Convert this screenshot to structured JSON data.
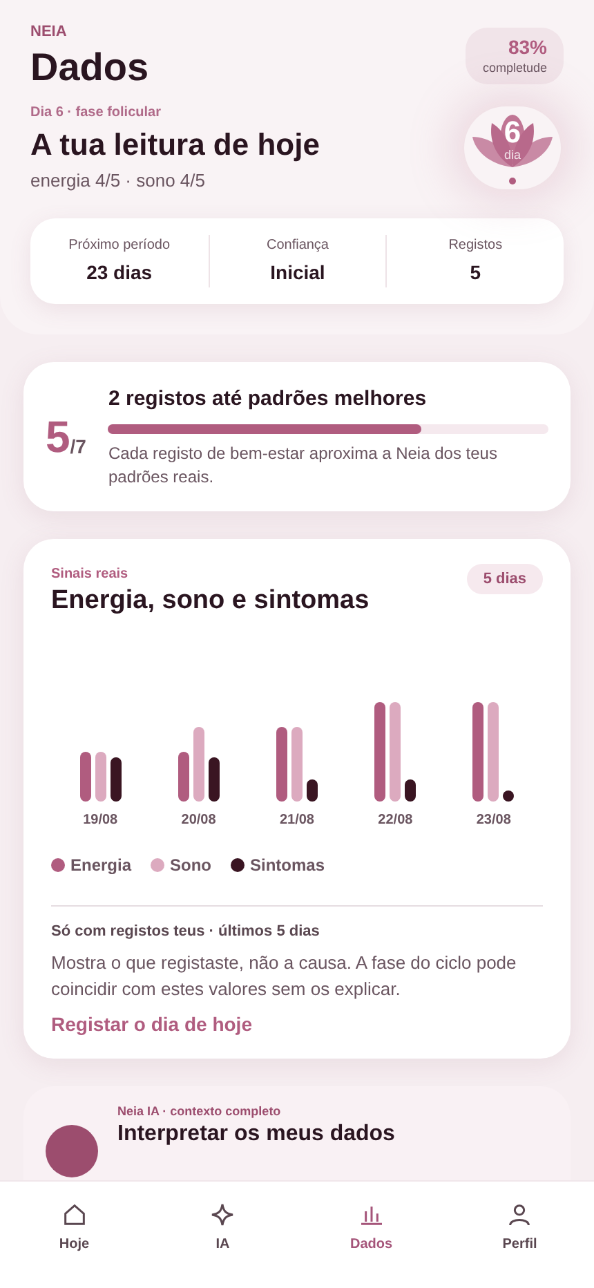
{
  "header": {
    "brand": "NEIA",
    "title": "Dados",
    "completeness": {
      "value": "83%",
      "label": "completude"
    }
  },
  "today": {
    "eyebrow": "Dia 6 · fase folicular",
    "title": "A tua leitura de hoje",
    "summary": "energia 4/5 · sono 4/5",
    "badge": {
      "number": "6",
      "label": "dia"
    }
  },
  "stats": [
    {
      "label": "Próximo período",
      "value": "23 dias"
    },
    {
      "label": "Confiança",
      "value": "Inicial"
    },
    {
      "label": "Registos",
      "value": "5"
    }
  ],
  "progress": {
    "count": "5",
    "total": "/7",
    "title": "2 registos até padrões melhores",
    "level": 0.71,
    "text": "Cada registo de bem-estar aproxima a Neia dos teus padrões reais."
  },
  "signals": {
    "eyebrow": "Sinais reais",
    "title": "Energia, sono e sintomas",
    "badge": "5 dias",
    "dates": [
      "19/08",
      "20/08",
      "21/08",
      "22/08",
      "23/08"
    ],
    "legend": [
      {
        "label": "Energia",
        "color": "#b05c7f"
      },
      {
        "label": "Sono",
        "color": "#dcaabf"
      },
      {
        "label": "Sintomas",
        "color": "#3a1522"
      }
    ],
    "note_title": "Só com registos teus · últimos 5 dias",
    "note": "Mostra o que registaste, não a causa. A fase do ciclo pode coincidir com estes valores sem os explicar.",
    "link": "Registar o dia de hoje"
  },
  "ai_card": {
    "eyebrow": "Neia IA · contexto completo",
    "title": "Interpretar os meus dados"
  },
  "nav": [
    {
      "label": "Hoje",
      "kind": "home",
      "selected": false
    },
    {
      "label": "IA",
      "kind": "assistant",
      "selected": false
    },
    {
      "label": "Dados",
      "kind": "data",
      "selected": true
    },
    {
      "label": "Perfil",
      "kind": "profile",
      "selected": false
    }
  ]
}
